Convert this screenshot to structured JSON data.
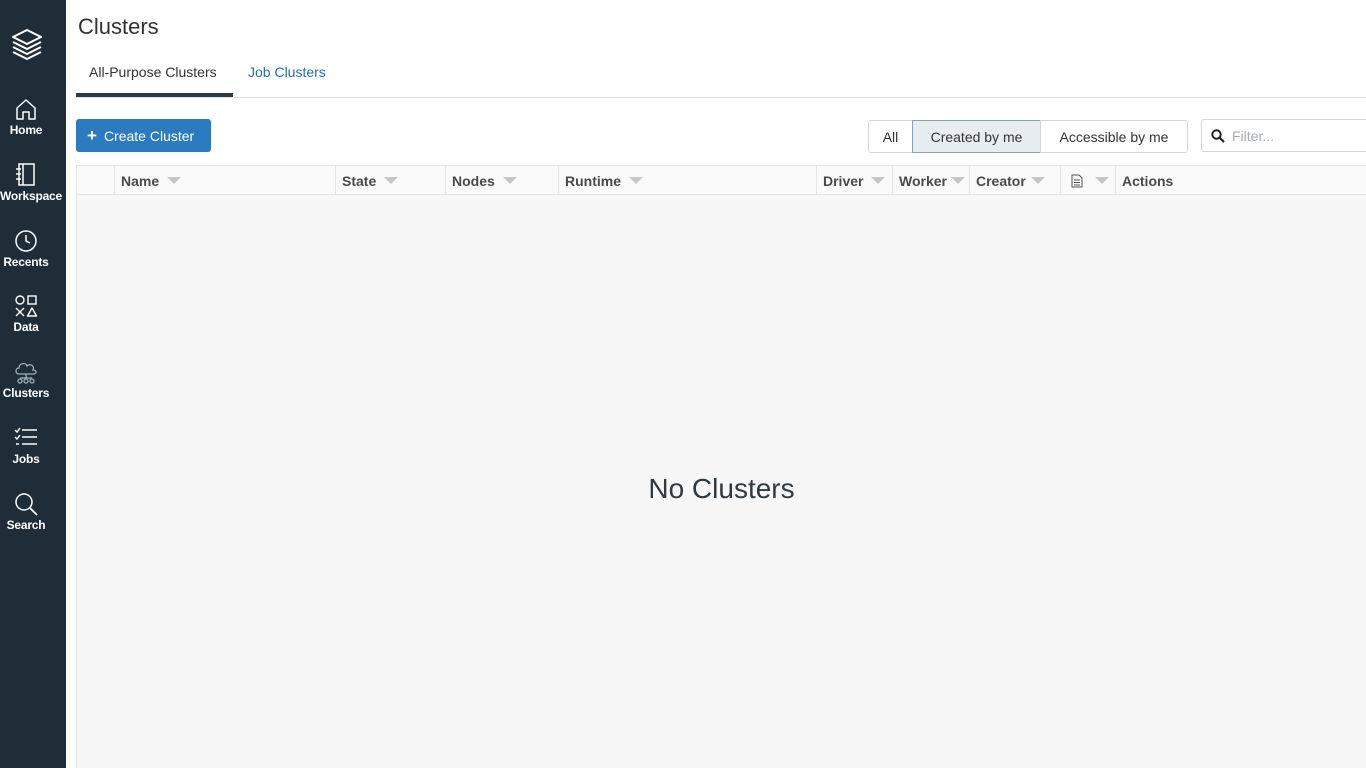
{
  "sidebar": {
    "logo_icon": "layers-logo-icon",
    "items": [
      {
        "label": "Home",
        "icon": "home-icon"
      },
      {
        "label": "Workspace",
        "icon": "workspace-icon"
      },
      {
        "label": "Recents",
        "icon": "clock-icon"
      },
      {
        "label": "Data",
        "icon": "data-shapes-icon"
      },
      {
        "label": "Clusters",
        "icon": "clusters-cloud-icon",
        "active": true
      },
      {
        "label": "Jobs",
        "icon": "jobs-list-icon"
      },
      {
        "label": "Search",
        "icon": "search-icon"
      }
    ]
  },
  "page": {
    "title": "Clusters"
  },
  "tabs": {
    "all_purpose": "All-Purpose Clusters",
    "job": "Job Clusters",
    "active": "all_purpose"
  },
  "toolbar": {
    "create_label": "Create Cluster",
    "segments": {
      "all": "All",
      "mine": "Created by me",
      "accessible": "Accessible by me",
      "selected": "mine"
    },
    "filter_placeholder": "Filter..."
  },
  "table": {
    "columns": {
      "name": "Name",
      "state": "State",
      "nodes": "Nodes",
      "runtime": "Runtime",
      "driver": "Driver",
      "worker": "Worker",
      "creator": "Creator",
      "notebook": "",
      "actions": "Actions"
    },
    "rows": [],
    "empty_message": "No Clusters"
  },
  "colors": {
    "sidebar_bg": "#1e2d37",
    "primary": "#2c7bc0",
    "link": "#1f6fb2"
  }
}
